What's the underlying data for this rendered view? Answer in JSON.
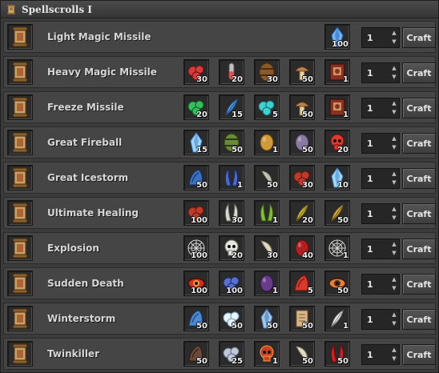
{
  "window": {
    "title": "Spellscrolls I",
    "icon": "scroll-icon"
  },
  "rows": [
    {
      "name": "Light Magic Missile",
      "scroll_icon": "light-missile-scroll-icon",
      "ingredients": [
        {
          "icon": "blue-crystal-icon",
          "qty": "100"
        }
      ],
      "quantity": "1",
      "craft_label": "Craft"
    },
    {
      "name": "Heavy Magic Missile",
      "scroll_icon": "heavy-missile-scroll-icon",
      "ingredients": [
        {
          "icon": "red-berries-icon",
          "qty": "30"
        },
        {
          "icon": "red-potion-icon",
          "qty": "20"
        },
        {
          "icon": "wooden-barrel-icon",
          "qty": "30"
        },
        {
          "icon": "mushroom-icon",
          "qty": "50"
        },
        {
          "icon": "red-spellbook-icon",
          "qty": "1"
        }
      ],
      "quantity": "1",
      "craft_label": "Craft"
    },
    {
      "name": "Freeze Missile",
      "scroll_icon": "freeze-missile-scroll-icon",
      "ingredients": [
        {
          "icon": "green-leaves-icon",
          "qty": "20"
        },
        {
          "icon": "blue-feather-icon",
          "qty": "15"
        },
        {
          "icon": "teal-orbs-icon",
          "qty": "5"
        },
        {
          "icon": "mushroom-icon",
          "qty": "50"
        },
        {
          "icon": "red-spellbook-icon",
          "qty": "1"
        }
      ],
      "quantity": "1",
      "craft_label": "Craft"
    },
    {
      "name": "Great Fireball",
      "scroll_icon": "fireball-scroll-icon",
      "ingredients": [
        {
          "icon": "ice-shard-icon",
          "qty": "15"
        },
        {
          "icon": "green-jar-icon",
          "qty": "50"
        },
        {
          "icon": "golden-egg-icon",
          "qty": "1"
        },
        {
          "icon": "purple-egg-icon",
          "qty": "50"
        },
        {
          "icon": "red-skull-icon",
          "qty": "20"
        }
      ],
      "quantity": "1",
      "craft_label": "Craft"
    },
    {
      "name": "Great Icestorm",
      "scroll_icon": "icestorm-scroll-icon",
      "ingredients": [
        {
          "icon": "blue-claw-icon",
          "qty": "50"
        },
        {
          "icon": "blue-horns-icon",
          "qty": "1"
        },
        {
          "icon": "dark-tusk-icon",
          "qty": "50"
        },
        {
          "icon": "red-flower-icon",
          "qty": "30"
        },
        {
          "icon": "ice-shard-icon",
          "qty": "10"
        }
      ],
      "quantity": "1",
      "craft_label": "Craft"
    },
    {
      "name": "Ultimate Healing",
      "scroll_icon": "healing-scroll-icon",
      "ingredients": [
        {
          "icon": "red-flower-icon",
          "qty": "100"
        },
        {
          "icon": "white-horns-icon",
          "qty": "30"
        },
        {
          "icon": "green-horns-icon",
          "qty": "1"
        },
        {
          "icon": "yellow-feather-icon",
          "qty": "20"
        },
        {
          "icon": "golden-wings-icon",
          "qty": "50"
        }
      ],
      "quantity": "1",
      "craft_label": "Craft"
    },
    {
      "name": "Explosion",
      "scroll_icon": "explosion-scroll-icon",
      "ingredients": [
        {
          "icon": "spider-web-icon",
          "qty": "100"
        },
        {
          "icon": "white-skull-icon",
          "qty": "20"
        },
        {
          "icon": "bone-fang-icon",
          "qty": "30"
        },
        {
          "icon": "red-sack-icon",
          "qty": "40"
        },
        {
          "icon": "bone-scroll-icon",
          "qty": "1"
        }
      ],
      "quantity": "1",
      "craft_label": "Craft"
    },
    {
      "name": "Sudden Death",
      "scroll_icon": "death-scroll-icon",
      "ingredients": [
        {
          "icon": "red-eye-icon",
          "qty": "100"
        },
        {
          "icon": "spiked-orb-icon",
          "qty": "100"
        },
        {
          "icon": "dark-heart-icon",
          "qty": "1"
        },
        {
          "icon": "red-claw-icon",
          "qty": "5"
        },
        {
          "icon": "orange-eye-icon",
          "qty": "50"
        }
      ],
      "quantity": "1",
      "craft_label": "Craft"
    },
    {
      "name": "Winterstorm",
      "scroll_icon": "winterstorm-scroll-icon",
      "ingredients": [
        {
          "icon": "blue-scale-icon",
          "qty": "50"
        },
        {
          "icon": "snowball-icon",
          "qty": "50"
        },
        {
          "icon": "ice-crystal-icon",
          "qty": "50"
        },
        {
          "icon": "parchment-icon",
          "qty": "50"
        },
        {
          "icon": "white-feather-icon",
          "qty": "1"
        }
      ],
      "quantity": "1",
      "craft_label": "Craft"
    },
    {
      "name": "Twinkiller",
      "scroll_icon": "twinkiller-scroll-icon",
      "ingredients": [
        {
          "icon": "dark-claw-icon",
          "qty": "50"
        },
        {
          "icon": "silver-coin-icon",
          "qty": "25"
        },
        {
          "icon": "red-demon-icon",
          "qty": "1"
        },
        {
          "icon": "bone-icon",
          "qty": "50"
        },
        {
          "icon": "red-horn-icon",
          "qty": "50"
        }
      ],
      "quantity": "1",
      "craft_label": "Craft"
    }
  ]
}
